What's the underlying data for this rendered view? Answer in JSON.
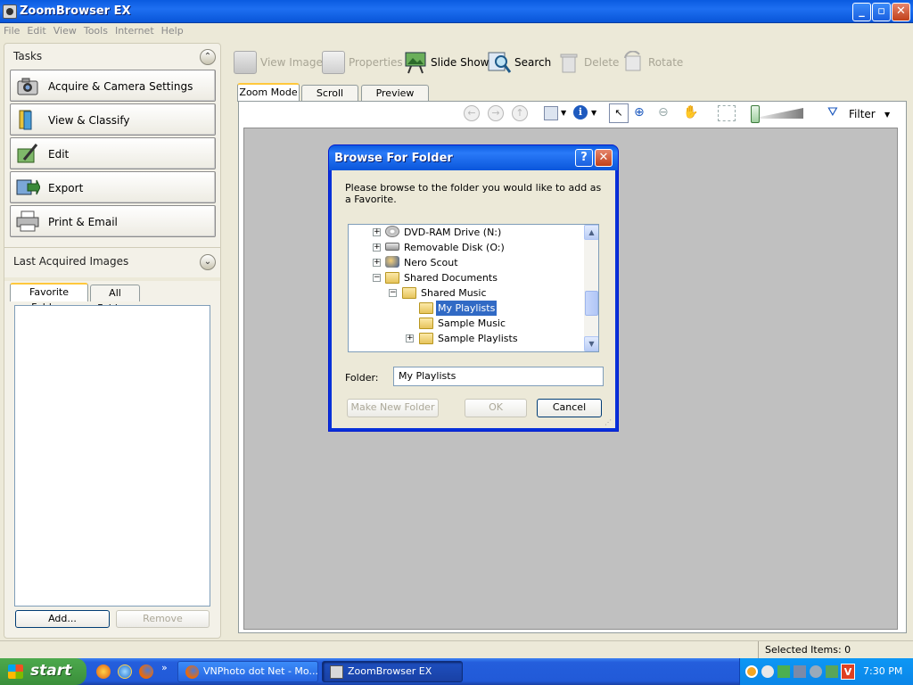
{
  "app": {
    "title": "ZoomBrowser EX"
  },
  "menu": [
    "File",
    "Edit",
    "View",
    "Tools",
    "Internet",
    "Help"
  ],
  "tasks": {
    "header": "Tasks",
    "items": [
      {
        "label": "Acquire & Camera Settings",
        "icon": "camera-icon"
      },
      {
        "label": "View & Classify",
        "icon": "classify-icon"
      },
      {
        "label": "Edit",
        "icon": "edit-icon"
      },
      {
        "label": "Export",
        "icon": "export-icon"
      },
      {
        "label": "Print & Email",
        "icon": "printer-icon"
      }
    ]
  },
  "last_acquired": {
    "header": "Last Acquired Images"
  },
  "folders": {
    "tabs": [
      "Favorite Folders",
      "All Folders"
    ],
    "add_label": "Add...",
    "remove_label": "Remove"
  },
  "toolbar": {
    "view_image": "View Image",
    "properties": "Properties",
    "slide_show": "Slide Show",
    "search": "Search",
    "delete": "Delete",
    "rotate": "Rotate"
  },
  "view_tabs": [
    "Zoom Mode",
    "Scroll Mode",
    "Preview Mode"
  ],
  "filter_label": "Filter",
  "dialog": {
    "title": "Browse For Folder",
    "instruction": "Please browse to the folder you would like to add as a Favorite.",
    "folder_label": "Folder:",
    "folder_value": "My Playlists",
    "make_new_folder": "Make New Folder",
    "ok": "OK",
    "cancel": "Cancel",
    "tree": [
      {
        "label": "DVD-RAM Drive (N:)",
        "expander": "+",
        "icon": "dvd-drive-icon"
      },
      {
        "label": "Removable Disk (O:)",
        "expander": "+",
        "icon": "removable-disk-icon"
      },
      {
        "label": "Nero Scout",
        "expander": "+",
        "icon": "nero-scout-icon"
      },
      {
        "label": "Shared Documents",
        "expander": "−",
        "icon": "folder-icon"
      },
      {
        "label": "Shared Music",
        "expander": "−",
        "icon": "music-folder-icon"
      },
      {
        "label": "My Playlists",
        "expander": "",
        "icon": "folder-icon",
        "selected": true
      },
      {
        "label": "Sample Music",
        "expander": "",
        "icon": "folder-icon"
      },
      {
        "label": "Sample Playlists",
        "expander": "+",
        "icon": "folder-icon"
      }
    ]
  },
  "status": {
    "selected_items": "Selected Items: 0"
  },
  "taskbar": {
    "start_label": "start",
    "items": [
      {
        "label": "VNPhoto dot Net - Mo...",
        "active": false
      },
      {
        "label": "ZoomBrowser EX",
        "active": true
      }
    ],
    "clock": "7:30 PM"
  },
  "colors": {
    "xp_blue": "#0A5BE0",
    "selection": "#316AC5",
    "start_green": "#3A8F3A"
  }
}
